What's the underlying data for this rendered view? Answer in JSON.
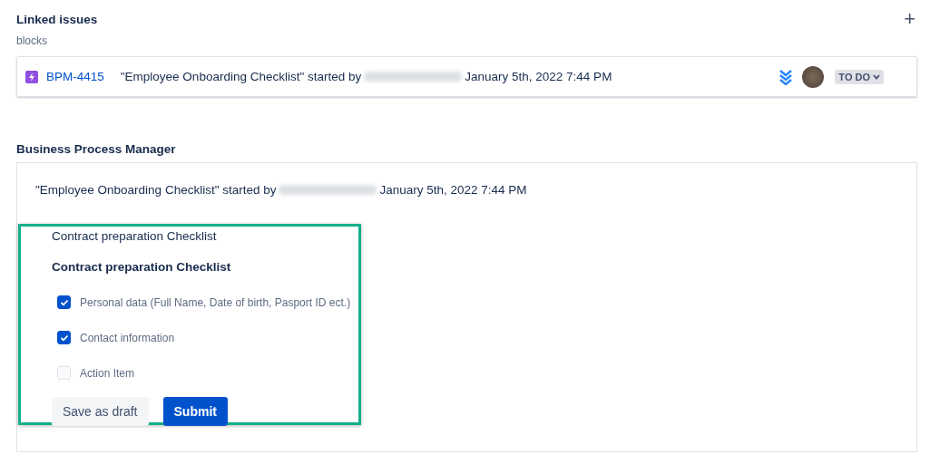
{
  "linked_issues": {
    "title": "Linked issues",
    "add_label": "+",
    "relation": "blocks",
    "issue": {
      "key": "BPM-4415",
      "summary": "\"Employee Onboarding Checklist\" started by",
      "date": "January 5th, 2022 7:44 PM",
      "status": "TO DO"
    }
  },
  "bpm": {
    "title": "Business Process Manager",
    "started": "\"Employee Onboarding Checklist\" started by",
    "date": "January 5th, 2022 7:44 PM",
    "form": {
      "title": "Contract preparation Checklist",
      "checklist_title": "Contract preparation Checklist",
      "items": [
        {
          "label": "Personal data (Full Name, Date of birth, Pasport ID ect.)",
          "checked": true
        },
        {
          "label": "Contact information",
          "checked": true
        },
        {
          "label": "Action Item",
          "checked": false
        }
      ],
      "buttons": [
        {
          "label": "Save as draft",
          "kind": "secondary"
        },
        {
          "label": "Submit",
          "kind": "primary"
        }
      ]
    }
  }
}
